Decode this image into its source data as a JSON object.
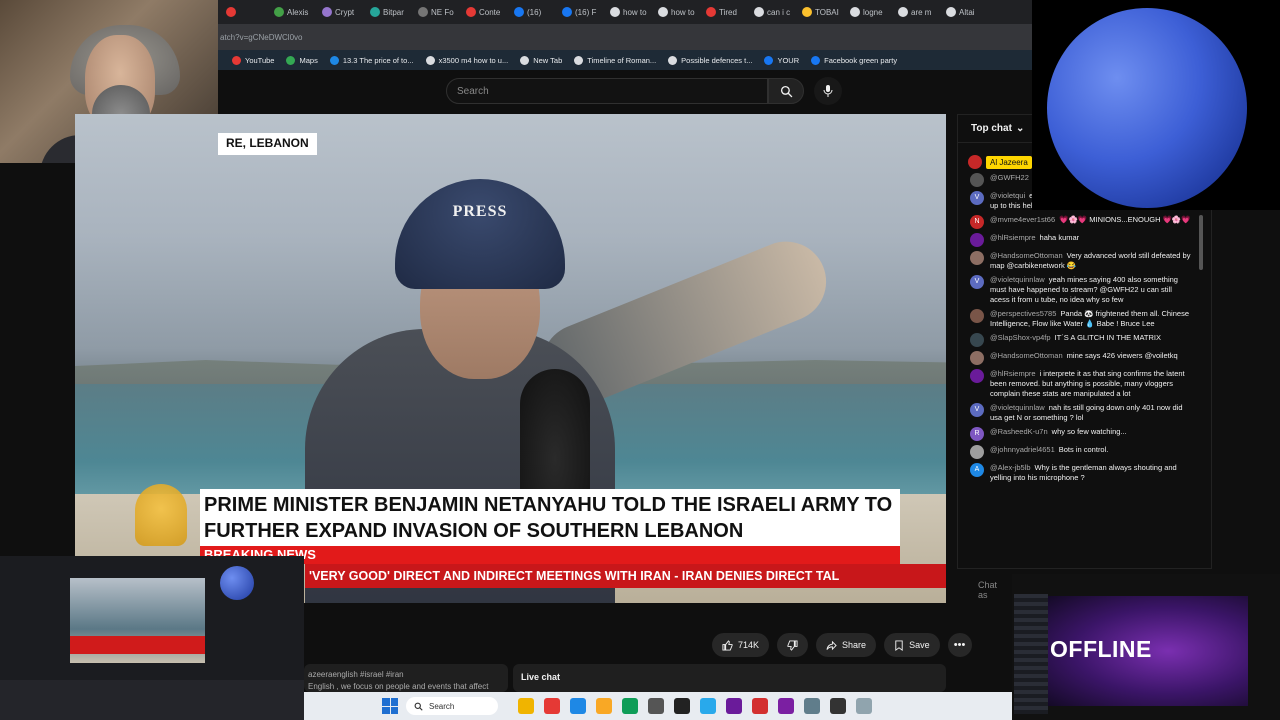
{
  "browser": {
    "tabs": [
      {
        "label": "",
        "color": "#e53935",
        "active": false
      },
      {
        "label": "Alexis",
        "color": "#43a047",
        "active": false
      },
      {
        "label": "Crypt",
        "color": "#9575cd",
        "active": false
      },
      {
        "label": "Bitpar",
        "color": "#26a69a",
        "active": false
      },
      {
        "label": "NE Fo",
        "color": "#757575",
        "active": false
      },
      {
        "label": "Conte",
        "color": "#e53935",
        "active": false
      },
      {
        "label": "(16)",
        "color": "#1877f2",
        "active": false
      },
      {
        "label": "(16) F",
        "color": "#1877f2",
        "active": false
      },
      {
        "label": "how to",
        "color": "#dadce0",
        "active": false
      },
      {
        "label": "how to",
        "color": "#dadce0",
        "active": false
      },
      {
        "label": "Tired",
        "color": "#e53935",
        "active": false
      },
      {
        "label": "can i c",
        "color": "#dadce0",
        "active": false
      },
      {
        "label": "TOBAI",
        "color": "#fbc02d",
        "active": false
      },
      {
        "label": "logne",
        "color": "#dadce0",
        "active": false
      },
      {
        "label": "are m",
        "color": "#dadce0",
        "active": false
      },
      {
        "label": "Altai",
        "color": "#dadce0",
        "active": false
      }
    ],
    "url": "atch?v=gCNeDWCl0vo",
    "bookmarks": [
      {
        "label": "YouTube",
        "color": "#e53935"
      },
      {
        "label": "Maps",
        "color": "#34a853"
      },
      {
        "label": "13.3 The price of to...",
        "color": "#1e88e5"
      },
      {
        "label": "x3500 m4 how to u...",
        "color": "#dadce0"
      },
      {
        "label": "New Tab",
        "color": "#dadce0"
      },
      {
        "label": "Timeline of Roman...",
        "color": "#dadce0"
      },
      {
        "label": "Possible defences t...",
        "color": "#dadce0"
      },
      {
        "label": "YOUR",
        "color": "#1877f2"
      },
      {
        "label": "Facebook green party",
        "color": "#1877f2"
      }
    ]
  },
  "youtube": {
    "search_placeholder": "Search",
    "video": {
      "location": "RE, LEBANON",
      "helmet_text": "PRESS",
      "headline": "PRIME MINISTER BENJAMIN NETANYAHU TOLD THE ISRAELI ARMY TO FURTHER EXPAND INVASION OF SOUTHERN LEBANON",
      "breaking_label": "BREAKING NEWS",
      "ticker": "'VERY GOOD' DIRECT AND INDIRECT MEETINGS WITH IRAN  -  IRAN DENIES DIRECT TAL"
    },
    "actions": {
      "likes": "714K",
      "share": "Share",
      "save": "Save"
    },
    "description": "azeeraenglish #israel #iran\nEnglish , we focus on people and events that affect",
    "live_chat_label": "Live chat"
  },
  "chat": {
    "header": "Top chat",
    "pinned_label": "Al Jazeera",
    "input_placeholder": "Chat as",
    "messages": [
      {
        "author": "@GWFH22",
        "text": "",
        "avatar_color": "#555",
        "initial": ""
      },
      {
        "author": "@violetqui",
        "text": "entire term with a new crisis to distract scaling up to this heh",
        "avatar_color": "#5c6bc0",
        "initial": "V"
      },
      {
        "author": "@mvme4ever1st66",
        "text": "💗🌸💗 MINIONS...ENOUGH 💗🌸💗",
        "avatar_color": "#c62828",
        "initial": "N"
      },
      {
        "author": "@hlRsiempre",
        "text": "haha kumar",
        "avatar_color": "#6a1b9a",
        "initial": ""
      },
      {
        "author": "@HandsomeOttoman",
        "text": "Very advanced world still defeated by map @carbikenetwork 😂",
        "avatar_color": "#8d6e63",
        "initial": ""
      },
      {
        "author": "@violetquinnlaw",
        "text": "yeah mines saying 400 also something must have happened to stream? @GWFH22 u can still acess it from u tube, no idea why so few",
        "avatar_color": "#5c6bc0",
        "initial": "V"
      },
      {
        "author": "@perspectives5785",
        "text": "Panda 🐼 frightened them all. Chinese Intelligence, Flow like Water 💧 Babe ! Bruce Lee",
        "avatar_color": "#795548",
        "initial": ""
      },
      {
        "author": "@SlapShox-vp4fp",
        "text": "IT´S A GLITCH IN THE MATRIX",
        "avatar_color": "#37474f",
        "initial": ""
      },
      {
        "author": "@HandsomeOttoman",
        "text": "mine says 426 viewers @voiletkq",
        "avatar_color": "#8d6e63",
        "initial": ""
      },
      {
        "author": "@hlRsiempre",
        "text": "i interprete it as that sing confirms the latent been removed. but anything is possible, many vloggers complain these stats are manipulated a lot",
        "avatar_color": "#6a1b9a",
        "initial": ""
      },
      {
        "author": "@violetquinnlaw",
        "text": "nah its still going down only 401 now did usa get N or something ? lol",
        "avatar_color": "#5c6bc0",
        "initial": "V"
      },
      {
        "author": "@RasheedK-u7n",
        "text": "why so few watching...",
        "avatar_color": "#7e57c2",
        "initial": "R"
      },
      {
        "author": "@johnnyadriel4651",
        "text": "Bots in control.",
        "avatar_color": "#9e9e9e",
        "initial": ""
      },
      {
        "author": "@Alex-jb5lb",
        "text": "Why is the gentleman always shouting and yelling into his microphone ?",
        "avatar_color": "#1e88e5",
        "initial": "A"
      }
    ]
  },
  "offline_panel": {
    "label": "OFFLINE"
  },
  "taskbar": {
    "search_label": "Search",
    "icons": [
      {
        "name": "file-explorer-icon",
        "color": "#f0b400"
      },
      {
        "name": "chrome-icon",
        "color": "#e53935"
      },
      {
        "name": "edge-icon",
        "color": "#1e88e5"
      },
      {
        "name": "folder-icon",
        "color": "#f9a825"
      },
      {
        "name": "edge-icon-2",
        "color": "#0f9d58"
      },
      {
        "name": "calculator-icon",
        "color": "#555"
      },
      {
        "name": "obs-icon",
        "color": "#222"
      },
      {
        "name": "telegram-icon",
        "color": "#29a9eb"
      },
      {
        "name": "app-icon",
        "color": "#6a1b9a"
      },
      {
        "name": "acrobat-icon",
        "color": "#d32f2f"
      },
      {
        "name": "paint-icon",
        "color": "#7b1fa2"
      },
      {
        "name": "settings-icon",
        "color": "#607d8b"
      },
      {
        "name": "chrome-icon-2",
        "color": "#333"
      },
      {
        "name": "remote-icon",
        "color": "#90a4ae"
      }
    ]
  }
}
